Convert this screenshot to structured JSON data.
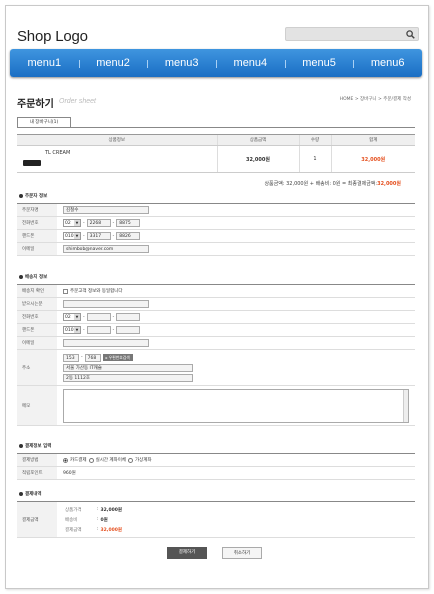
{
  "header": {
    "logo": "Shop Logo",
    "search_placeholder": ""
  },
  "nav": [
    "menu1",
    "menu2",
    "menu3",
    "menu4",
    "menu5",
    "menu6"
  ],
  "page": {
    "title": "주문하기",
    "subtitle": "Order sheet",
    "breadcrumb": "HOME > 장바구니 > 주문/결제 작성"
  },
  "tab": "내 장바구니(1)",
  "product_table": {
    "headers": [
      "상품정보",
      "상품금액",
      "수량",
      "합계"
    ],
    "rows": [
      {
        "name": "TL CREAM",
        "price": "32,000원",
        "qty": "1",
        "total": "32,000원"
      }
    ]
  },
  "totals": {
    "text": "상품금액: 32,000원 + 배송비: 0원 = 최종결제금액:",
    "final": "32,000원"
  },
  "orderer": {
    "title": "주문자 정보",
    "name_label": "주문자명",
    "name_value": "김철수",
    "phone_label": "전화번호",
    "phone": [
      "02",
      "2268",
      "8875"
    ],
    "mobile_label": "핸드폰",
    "mobile": [
      "010",
      "3317",
      "8826"
    ],
    "email_label": "이메일",
    "email_value": "shimbob@naver.com"
  },
  "shipping": {
    "title": "배송지 정보",
    "confirm_label": "배송지 확인",
    "confirm_text": "주문고객 정보와 동일합니다",
    "receiver_label": "받으시는분",
    "phone_label": "전화번호",
    "phone_area": "02",
    "mobile_label": "핸드폰",
    "mobile_prefix": "010",
    "email_label": "이메일",
    "address_label": "주소",
    "zip": [
      "153",
      "768"
    ],
    "zip_button": "우편번호검색",
    "address1": "서울 가산동 IT캐슬",
    "address2": "2동 1112호",
    "memo_label": "메모"
  },
  "payment": {
    "title": "결제정보 입력",
    "method_label": "결제방법",
    "methods": [
      "카드결제",
      "실시간 계좌이체",
      "가상계좌"
    ],
    "points_label": "적립포인트",
    "points_value": "960원"
  },
  "summary": {
    "title": "결제내역",
    "amount_label": "결제금액",
    "product_label": "상품가격",
    "product_value": "32,000원",
    "ship_label": "배송비",
    "ship_value": "0원",
    "pay_label": "결제금액",
    "pay_value": "32,000원"
  },
  "buttons": {
    "pay": "결제하기",
    "cancel": "취소하기"
  },
  "colors": {
    "accent": "#1a6ec4",
    "price": "#e5501f"
  }
}
